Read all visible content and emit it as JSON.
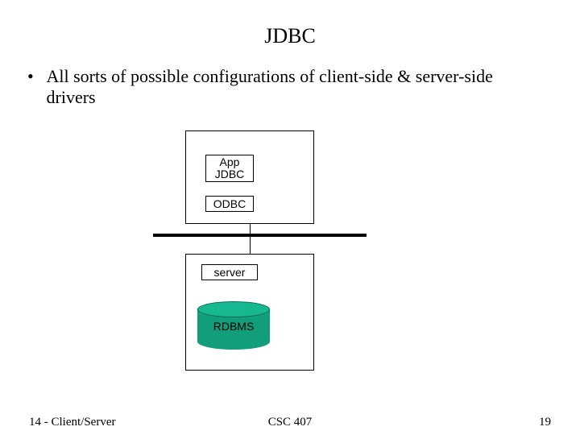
{
  "title": "JDBC",
  "bullet": "All sorts of possible configurations of client-side & server-side drivers",
  "boxes": {
    "app_l1": "App",
    "app_l2": "JDBC",
    "odbc": "ODBC",
    "server": "server",
    "rdbms": "RDBMS"
  },
  "footer": {
    "left": "14 - Client/Server",
    "center": "CSC 407",
    "right": "19"
  }
}
